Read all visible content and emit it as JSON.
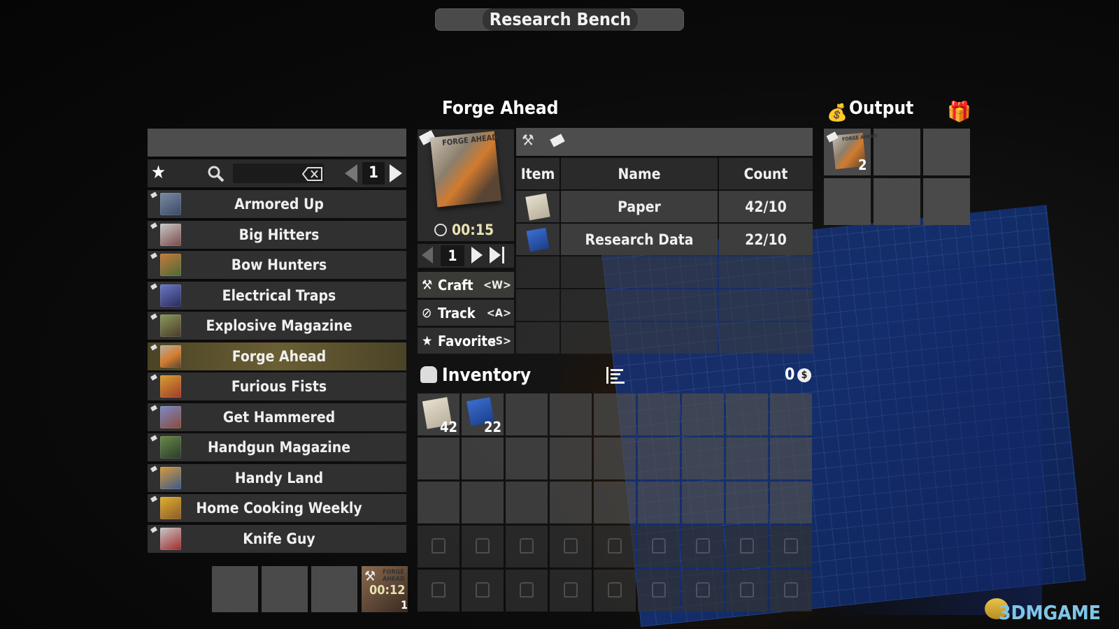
{
  "title": "Research Bench",
  "left_panel": {
    "page": "1",
    "search_placeholder": "",
    "recipes": [
      {
        "label": "Armored Up"
      },
      {
        "label": "Big Hitters"
      },
      {
        "label": "Bow Hunters"
      },
      {
        "label": "Electrical Traps"
      },
      {
        "label": "Explosive Magazine"
      },
      {
        "label": "Forge Ahead",
        "selected": true
      },
      {
        "label": "Furious Fists"
      },
      {
        "label": "Get Hammered"
      },
      {
        "label": "Handgun Magazine"
      },
      {
        "label": "Handy Land"
      },
      {
        "label": "Home Cooking Weekly"
      },
      {
        "label": "Knife Guy"
      }
    ]
  },
  "queue": {
    "active_timer": "00:12",
    "active_count": "1",
    "active_cover_text": "FORGE AHEAD"
  },
  "detail": {
    "title": "Forge Ahead",
    "cover_text": "FORGE AHEAD",
    "craft_time": "00:15",
    "count": "1",
    "actions": [
      {
        "label": "Craft",
        "key": "<W>",
        "icon": "hammer-icon"
      },
      {
        "label": "Track",
        "key": "<A>",
        "icon": "compass-icon"
      },
      {
        "label": "Favorite",
        "key": "<S>",
        "icon": "star-icon"
      }
    ]
  },
  "ingredients": {
    "headers": {
      "item": "Item",
      "name": "Name",
      "count": "Count"
    },
    "rows": [
      {
        "name": "Paper",
        "count": "42/10",
        "icon": "paper-icon"
      },
      {
        "name": "Research Data",
        "count": "22/10",
        "icon": "research-data-icon"
      }
    ]
  },
  "output": {
    "title": "Output",
    "item_count": "2",
    "item_cover_text": "FORGE AHEAD"
  },
  "inventory": {
    "title": "Inventory",
    "money": "0",
    "money_symbol": "$",
    "items": [
      {
        "icon": "paper-icon",
        "count": "42"
      },
      {
        "icon": "research-data-icon",
        "count": "22"
      }
    ]
  },
  "watermark": "3DMGAME"
}
